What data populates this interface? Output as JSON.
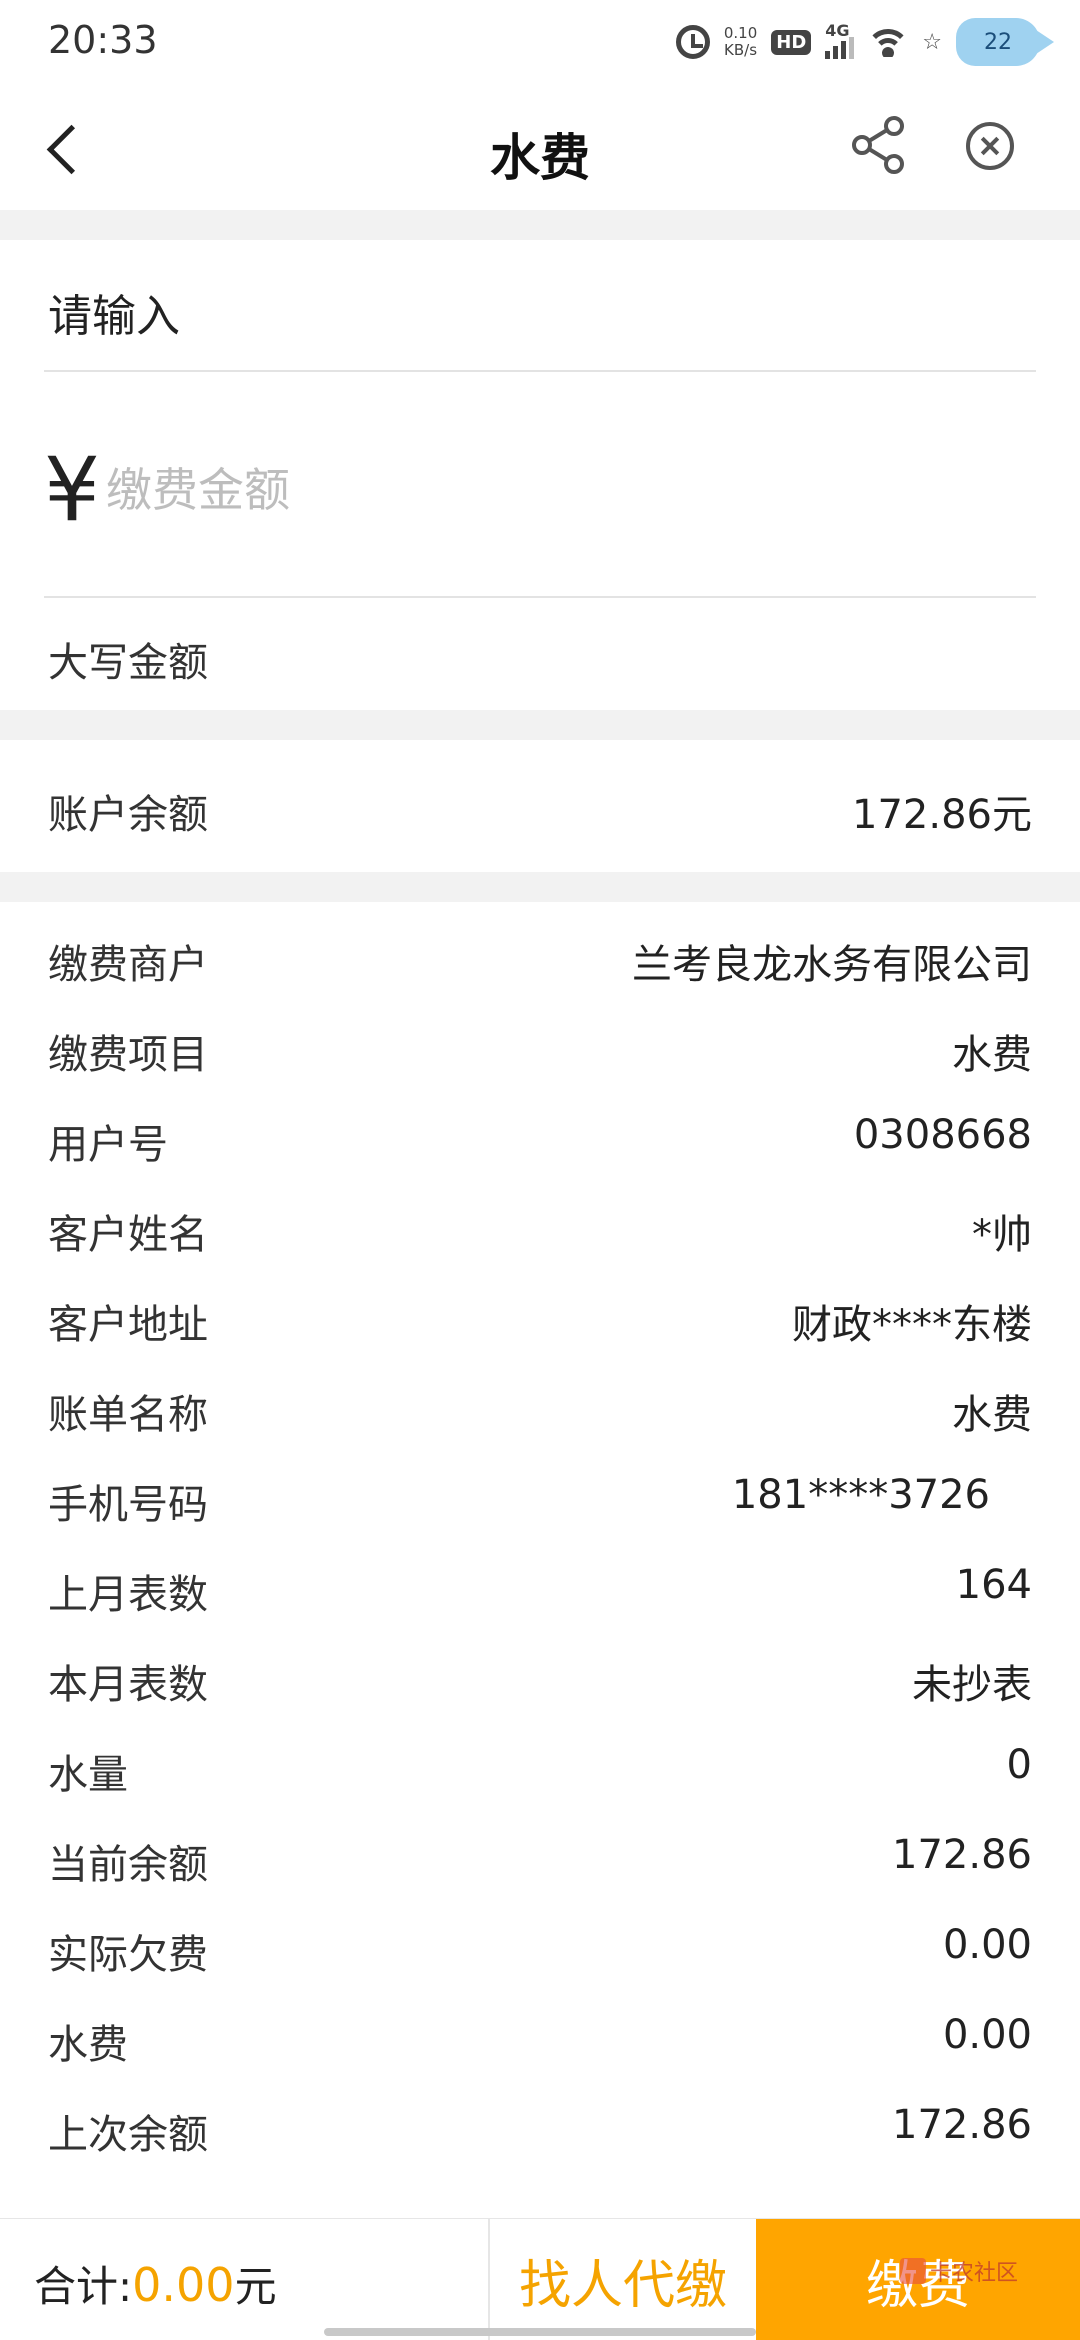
{
  "status_bar": {
    "time": "20:33",
    "net_speed_value": "0.10",
    "net_speed_unit": "KB/s",
    "hd_label": "HD",
    "network_label": "4G",
    "battery_level": "22"
  },
  "nav": {
    "title": "水费",
    "back_icon": "chevron-left-icon",
    "share_icon": "share-icon",
    "close_icon": "close-circle-icon"
  },
  "input_section": {
    "title": "请输入",
    "currency_symbol": "¥",
    "amount_placeholder": "缴费金额",
    "amount_value": "",
    "capital_label": "大写金额"
  },
  "balance": {
    "label": "账户余额",
    "value": "172.86元"
  },
  "details": [
    {
      "label": "缴费商户",
      "value": "兰考良龙水务有限公司"
    },
    {
      "label": "缴费项目",
      "value": "水费"
    },
    {
      "label": "用户号",
      "value": "0308668"
    },
    {
      "label": "客户姓名",
      "value": "*帅"
    },
    {
      "label": "客户地址",
      "value": "财政****东楼"
    },
    {
      "label": "账单名称",
      "value": "水费"
    },
    {
      "label": "手机号码",
      "value": "181****3726"
    },
    {
      "label": "上月表数",
      "value": "164"
    },
    {
      "label": "本月表数",
      "value": "未抄表"
    },
    {
      "label": "水量",
      "value": "0"
    },
    {
      "label": "当前余额",
      "value": "172.86"
    },
    {
      "label": "实际欠费",
      "value": "0.00"
    },
    {
      "label": "水费",
      "value": "0.00"
    },
    {
      "label": "上次余额",
      "value": "172.86"
    }
  ],
  "bottom": {
    "total_label": "合计:",
    "total_amount": "0.00",
    "total_unit": "元",
    "proxy_button": "找人代缴",
    "pay_button": "缴费",
    "watermark": "卡农社区"
  },
  "colors": {
    "accent": "#ffa500",
    "accent_text": "#f5a300"
  }
}
